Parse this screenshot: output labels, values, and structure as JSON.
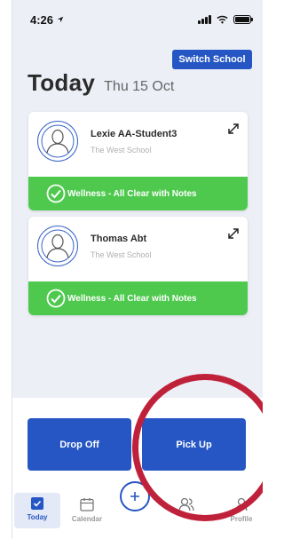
{
  "status_bar": {
    "time": "4:26"
  },
  "header": {
    "switch_school_label": "Switch School",
    "title": "Today",
    "date": "Thu 15 Oct"
  },
  "students": [
    {
      "name": "Lexie AA-Student3",
      "school": "The West School",
      "status": "Wellness - All Clear with Notes"
    },
    {
      "name": "Thomas Abt",
      "school": "The West School",
      "status": "Wellness - All Clear with Notes"
    }
  ],
  "actions": {
    "drop_off": "Drop Off",
    "pick_up": "Pick Up"
  },
  "tabs": [
    {
      "label": "Today",
      "icon": "checkbox-icon",
      "active": true
    },
    {
      "label": "Calendar",
      "icon": "calendar-icon",
      "active": false
    },
    {
      "label": "",
      "icon": "add-icon",
      "active": false
    },
    {
      "label": "",
      "icon": "people-icon",
      "active": false
    },
    {
      "label": "Profile",
      "icon": "person-icon",
      "active": false
    }
  ],
  "colors": {
    "primary": "#2556c4",
    "success": "#4ec94e",
    "highlight": "#c0213a",
    "background": "#edeff7"
  }
}
